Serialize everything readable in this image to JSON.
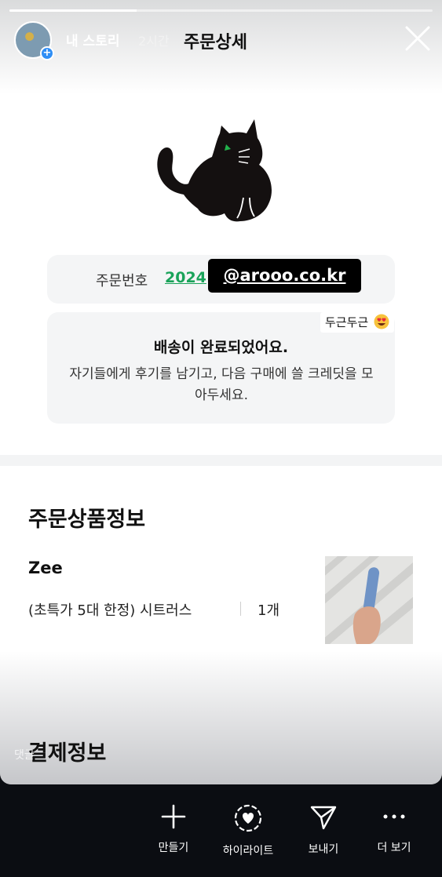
{
  "story": {
    "progress_fraction": 0.3,
    "user": "내 스토리",
    "time": "2시간",
    "close_icon": "close-icon"
  },
  "page": {
    "title": "주문상세"
  },
  "order": {
    "label": "주문번호",
    "number": "2024",
    "mention": "@arooo.co.kr"
  },
  "delivery": {
    "title": "배송이 완료되었어요.",
    "body": "자기들에게 후기를 남기고, 다음 구매에 쓸 크레딧을 모아두세요."
  },
  "sticker": {
    "text": "두근두근",
    "emoji": "heart-eyes-emoji"
  },
  "product_section": {
    "title": "주문상품정보",
    "brand": "Zee",
    "name": "(초특가 5대 한정) 시트러스",
    "quantity": "1개"
  },
  "payment_section": {
    "title": "결제정보"
  },
  "comment_hint": "댓글",
  "actions": [
    {
      "label": "만들기",
      "icon": "plus-icon"
    },
    {
      "label": "하이라이트",
      "icon": "highlight-heart-icon"
    },
    {
      "label": "보내기",
      "icon": "send-icon"
    },
    {
      "label": "더 보기",
      "icon": "more-icon"
    }
  ],
  "colors": {
    "accent_green": "#1aa35a",
    "background_dark": "#0b0d12",
    "card_gray": "#f4f5f6",
    "avatar_badge": "#2f8ef5"
  }
}
